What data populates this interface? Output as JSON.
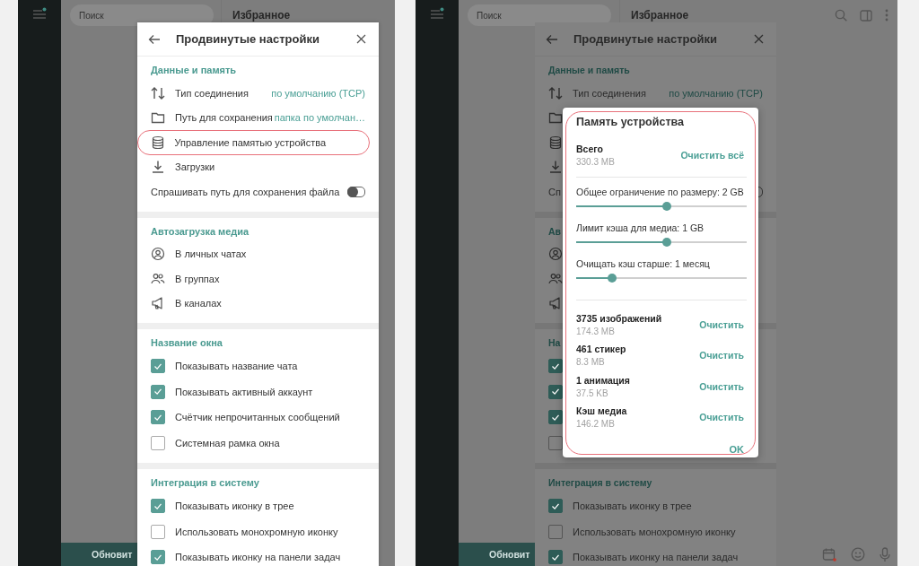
{
  "screens": [
    {
      "search": {
        "placeholder": "Поиск"
      },
      "chat_title": "Избранное",
      "chat_toolbar": false,
      "composer_icons": false,
      "update_button": "Обновит",
      "dialog": {
        "title": "Продвинутые настройки",
        "dimmed": false,
        "sections": [
          {
            "title": "Данные и память",
            "rows": [
              {
                "kind": "value",
                "label": "Тип соединения",
                "value": "по умолчанию (TCP)"
              },
              {
                "kind": "value",
                "label": "Путь для сохранения",
                "value": "папка по умолчан…"
              },
              {
                "kind": "link",
                "label": "Управление памятью устройства",
                "highlighted": true
              },
              {
                "kind": "link",
                "label": "Загрузки",
                "highlighted": false
              },
              {
                "kind": "toggle",
                "label": "Спрашивать путь для сохранения файла",
                "on": false
              }
            ]
          },
          {
            "title": "Автозагрузка медиа",
            "rows": [
              {
                "kind": "link",
                "label": "В личных чатах",
                "highlighted": false
              },
              {
                "kind": "link",
                "label": "В группах",
                "highlighted": false
              },
              {
                "kind": "link",
                "label": "В каналах",
                "highlighted": false
              }
            ]
          },
          {
            "title": "Название окна",
            "rows": [
              {
                "kind": "checkbox",
                "label": "Показывать название чата",
                "checked": true
              },
              {
                "kind": "checkbox",
                "label": "Показывать активный аккаунт",
                "checked": true
              },
              {
                "kind": "checkbox",
                "label": "Счётчик непрочитанных сообщений",
                "checked": true
              },
              {
                "kind": "checkbox",
                "label": "Системная рамка окна",
                "checked": false
              }
            ]
          },
          {
            "title": "Интеграция в систему",
            "rows": [
              {
                "kind": "checkbox",
                "label": "Показывать иконку в трее",
                "checked": true
              },
              {
                "kind": "checkbox",
                "label": "Использовать монохромную иконку",
                "checked": false
              },
              {
                "kind": "checkbox",
                "label": "Показывать иконку на панели задач",
                "checked": true
              }
            ]
          }
        ]
      }
    },
    {
      "search": {
        "placeholder": "Поиск"
      },
      "chat_title": "Избранное",
      "chat_toolbar": true,
      "composer_icons": true,
      "update_button": "Обновит",
      "dialog": {
        "title": "Продвинутые настройки",
        "dimmed": true,
        "sections": [
          {
            "title": "Данные и память",
            "rows": [
              {
                "kind": "value",
                "label": "Тип соединения",
                "value": "по умолчанию (TCP)"
              },
              {
                "kind": "value"
              },
              {
                "kind": "link",
                "highlighted": false
              },
              {
                "kind": "link",
                "highlighted": false
              },
              {
                "kind": "toggle",
                "label": "Сп",
                "on": false
              }
            ]
          },
          {
            "title": "Ав",
            "rows": [
              {
                "kind": "link",
                "highlighted": false
              },
              {
                "kind": "link",
                "highlighted": false
              },
              {
                "kind": "link",
                "highlighted": false
              }
            ]
          },
          {
            "title": "На",
            "rows": [
              {
                "kind": "checkbox",
                "checked": true
              },
              {
                "kind": "checkbox",
                "checked": true
              },
              {
                "kind": "checkbox",
                "checked": true
              },
              {
                "kind": "checkbox",
                "checked": false
              }
            ]
          },
          {
            "title": "Интеграция в систему",
            "rows": [
              {
                "kind": "checkbox",
                "label": "Показывать иконку в трее",
                "checked": true
              },
              {
                "kind": "checkbox",
                "label": "Использовать монохромную иконку",
                "checked": false
              },
              {
                "kind": "checkbox",
                "label": "Показывать иконку на панели задач",
                "checked": true
              }
            ]
          }
        ]
      },
      "memory_dialog": {
        "title": "Память устройства",
        "highlighted": true,
        "total": {
          "label": "Всего",
          "size": "330.3 MB",
          "action": "Очистить всё"
        },
        "sliders": [
          {
            "label": "Общее ограничение по размеру: 2 GB",
            "level": 0.53
          },
          {
            "label": "Лимит кэша для медиа: 1 GB",
            "level": 0.53
          },
          {
            "label": "Очищать кэш старше: 1 месяц",
            "level": 0.21
          }
        ],
        "items": [
          {
            "label": "3735 изображений",
            "size": "174.3 MB",
            "action": "Очистить"
          },
          {
            "label": "461 стикер",
            "size": "8.3 MB",
            "action": "Очистить"
          },
          {
            "label": "1 анимация",
            "size": "37.5 KB",
            "action": "Очистить"
          },
          {
            "label": "Кэш медиа",
            "size": "146.2 MB",
            "action": "Очистить"
          }
        ],
        "ok": "OK"
      }
    }
  ]
}
